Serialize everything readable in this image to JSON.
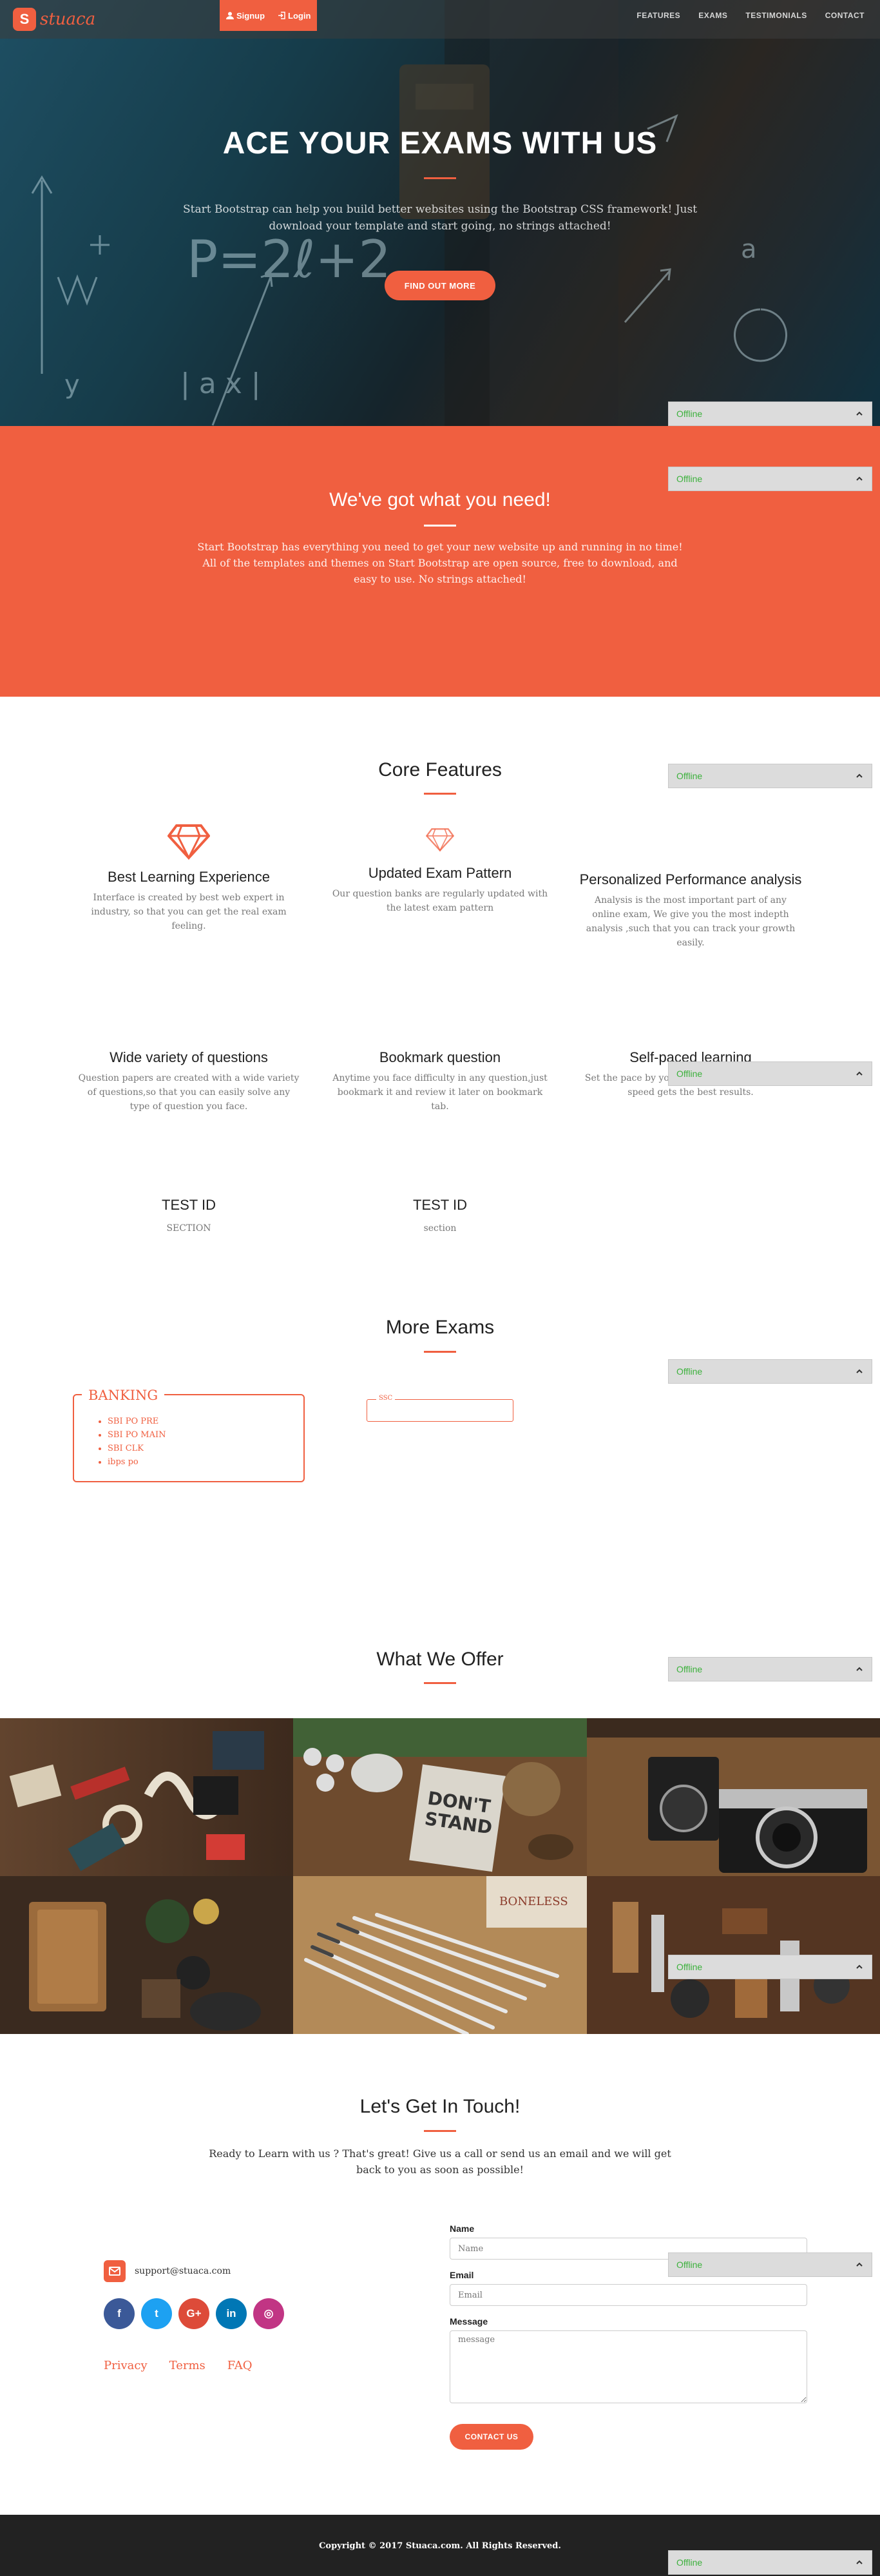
{
  "brand": {
    "badge": "S",
    "name": "stuaca"
  },
  "auth": {
    "signup": "Signup",
    "login": "Login"
  },
  "nav": {
    "features": "FEATURES",
    "exams": "EXAMS",
    "testimonials": "TESTIMONIALS",
    "contact": "CONTACT"
  },
  "hero": {
    "title": "ACE YOUR EXAMS WITH US",
    "text": "Start Bootstrap can help you build better websites using the Bootstrap CSS framework! Just download your template and start going, no strings attached!",
    "cta": "FIND OUT MORE"
  },
  "about": {
    "title": "We've got what you need!",
    "text": "Start Bootstrap has everything you need to get your new website up and running in no time! All of the templates and themes on Start Bootstrap are open source, free to download, and easy to use. No strings attached!"
  },
  "features": {
    "title": "Core Features",
    "items": [
      {
        "title": "Best Learning Experience",
        "text": "Interface is created by best web expert in industry, so that you can get the real exam feeling.",
        "icon": "diamond-icon"
      },
      {
        "title": "Updated Exam Pattern",
        "text": "Our question banks are regularly updated with the latest exam pattern",
        "icon": "diamond-icon"
      },
      {
        "title": "Personalized Performance analysis",
        "text": "Analysis is the most important part of any online exam, We give you the most indepth analysis ,such that you can track your growth easily.",
        "icon": ""
      },
      {
        "title": "Wide variety of questions",
        "text": "Question papers are created with a wide variety of questions,so that you can easily solve any type of question you face."
      },
      {
        "title": "Bookmark question",
        "text": "Anytime you face difficulty in any question,just bookmark it and review it later on bookmark tab."
      },
      {
        "title": "Self-paced learning",
        "text": "Set the pace by yourself, learning at your own speed gets the best results."
      }
    ],
    "tests": [
      {
        "title": "TEST ID",
        "sub": "SECTION"
      },
      {
        "title": "TEST ID",
        "sub": "section"
      }
    ]
  },
  "exams": {
    "title": "More Exams",
    "banking": {
      "label": "BANKING",
      "items": [
        "SBI PO PRE",
        "SBI PO MAIN",
        "SBI CLK",
        "ibps po"
      ]
    },
    "ssc": {
      "label": "SSC"
    }
  },
  "offer": {
    "title": "What We Offer"
  },
  "contact": {
    "title": "Let's Get In Touch!",
    "text": "Ready to Learn with us ? That's great! Give us a call or send us an email and we will get back to you as soon as possible!",
    "email": "support@stuaca.com",
    "links": [
      "Privacy",
      "Terms",
      "FAQ"
    ],
    "form": {
      "name_label": "Name",
      "name_ph": "Name",
      "email_label": "Email",
      "email_ph": "Email",
      "message_label": "Message",
      "message_ph": "message",
      "submit": "CONTACT US"
    },
    "socials": [
      {
        "name": "facebook-icon",
        "glyph": "f",
        "color": "#3b5998"
      },
      {
        "name": "twitter-icon",
        "glyph": "t",
        "color": "#1da1f2"
      },
      {
        "name": "google-plus-icon",
        "glyph": "G+",
        "color": "#dd4b39"
      },
      {
        "name": "linkedin-icon",
        "glyph": "in",
        "color": "#0077b5"
      },
      {
        "name": "instagram-icon",
        "glyph": "◎",
        "color": "#c13584"
      }
    ]
  },
  "footer": {
    "copyright": "Copyright © 2017 Stuaca.com. All Rights Reserved."
  },
  "offline": {
    "label": "Offline"
  },
  "colors": {
    "accent": "#f05f40",
    "dark": "#222222",
    "status_green": "#3cb13c"
  }
}
